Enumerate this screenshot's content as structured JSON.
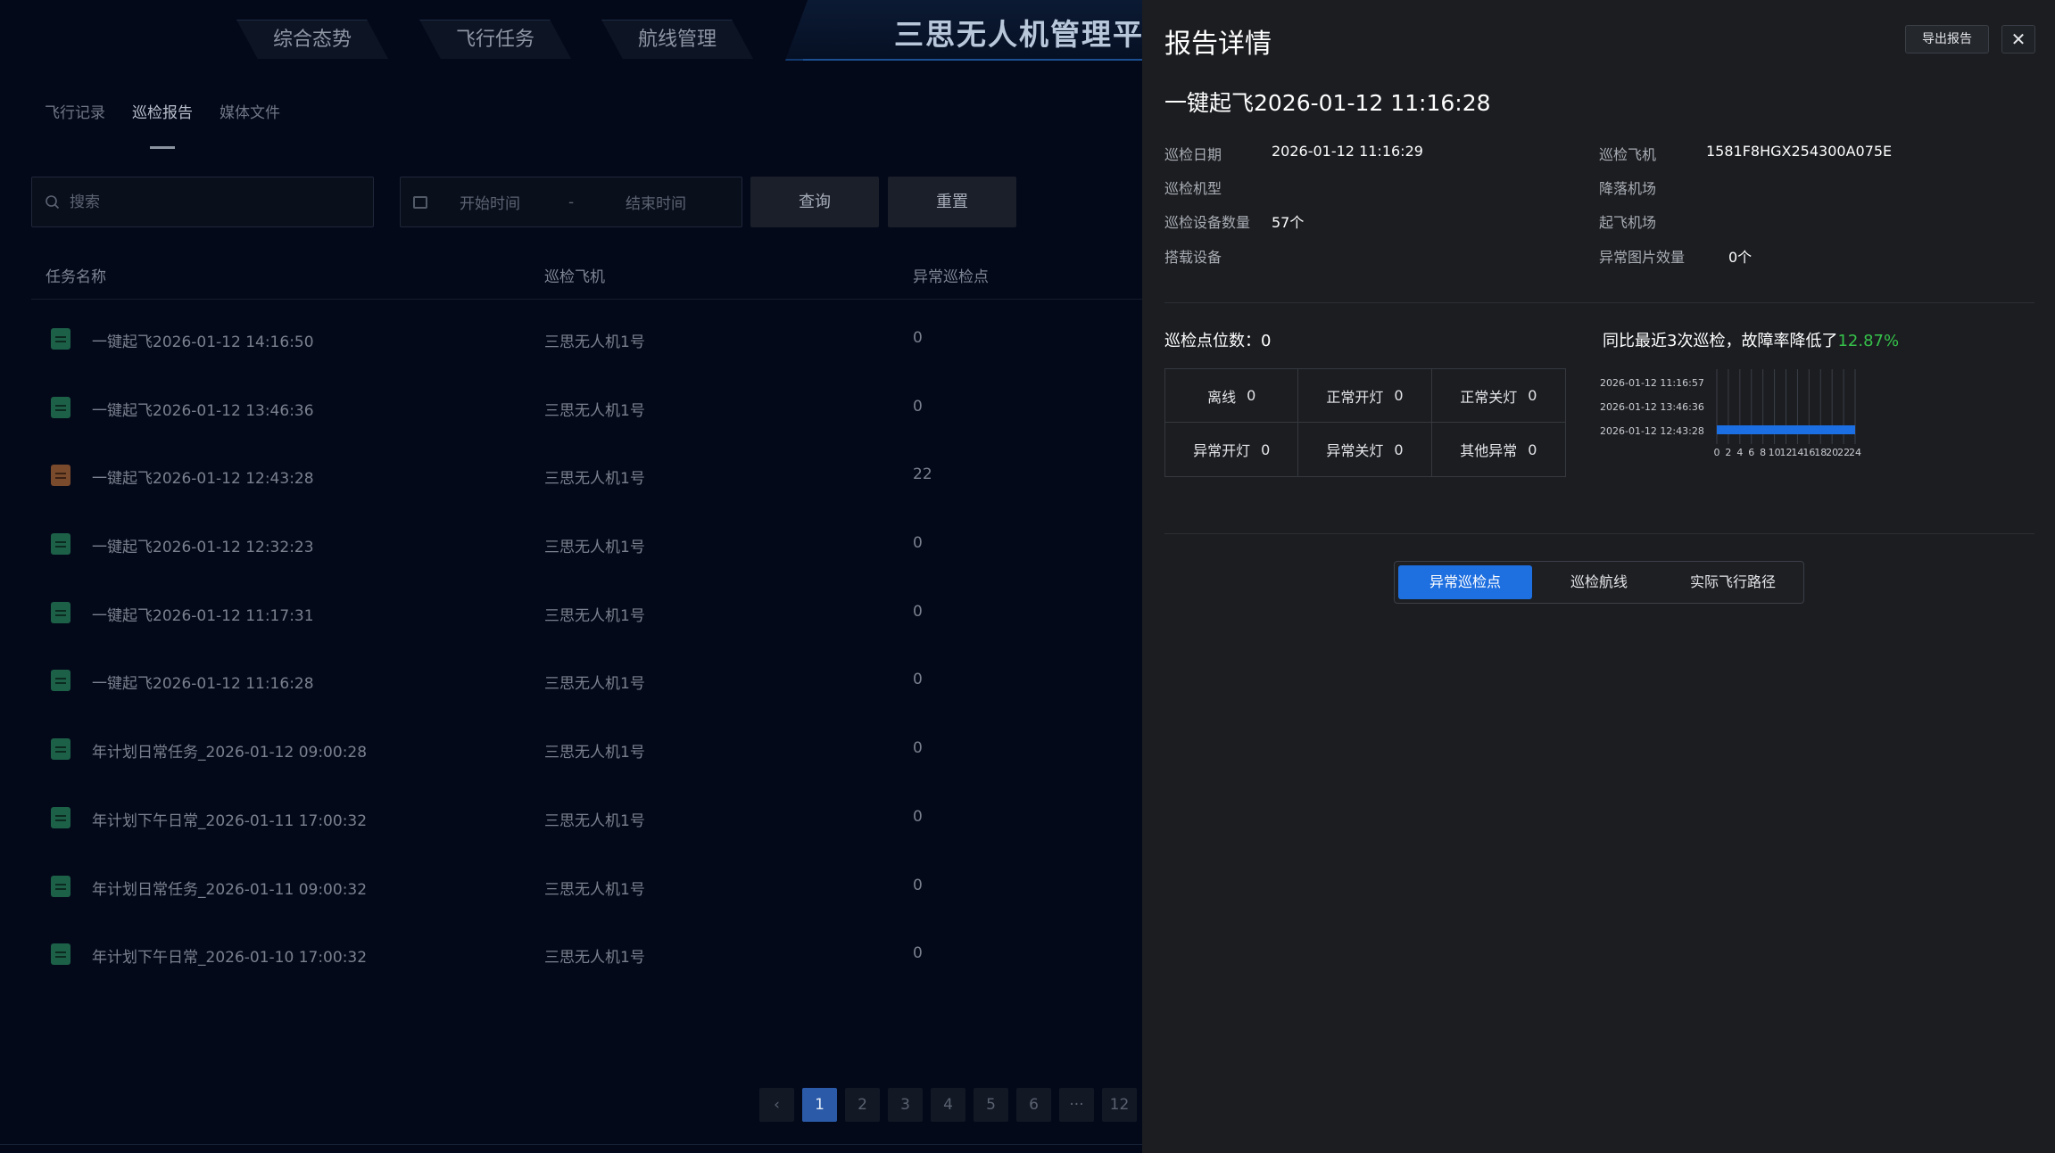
{
  "nav": {
    "tabs": [
      "综合态势",
      "飞行任务",
      "航线管理"
    ],
    "brand_title": "三思无人机管理平台"
  },
  "subtabs": [
    "飞行记录",
    "巡检报告",
    "媒体文件"
  ],
  "active_subtab": "巡检报告",
  "filters": {
    "search_placeholder": "搜索",
    "start_placeholder": "开始时间",
    "separator": "-",
    "end_placeholder": "结束时间",
    "query_label": "查询",
    "reset_label": "重置"
  },
  "table": {
    "headers": [
      "任务名称",
      "巡检飞机",
      "异常巡检点"
    ],
    "rows": [
      {
        "name": "一键起飞2026-01-12 14:16:50",
        "drone": "三思无人机1号",
        "abnormal": "0",
        "status": "normal"
      },
      {
        "name": "一键起飞2026-01-12 13:46:36",
        "drone": "三思无人机1号",
        "abnormal": "0",
        "status": "normal"
      },
      {
        "name": "一键起飞2026-01-12 12:43:28",
        "drone": "三思无人机1号",
        "abnormal": "22",
        "status": "warn"
      },
      {
        "name": "一键起飞2026-01-12 12:32:23",
        "drone": "三思无人机1号",
        "abnormal": "0",
        "status": "normal"
      },
      {
        "name": "一键起飞2026-01-12 11:17:31",
        "drone": "三思无人机1号",
        "abnormal": "0",
        "status": "normal"
      },
      {
        "name": "一键起飞2026-01-12 11:16:28",
        "drone": "三思无人机1号",
        "abnormal": "0",
        "status": "normal"
      },
      {
        "name": "年计划日常任务_2026-01-12 09:00:28",
        "drone": "三思无人机1号",
        "abnormal": "0",
        "status": "normal"
      },
      {
        "name": "年计划下午日常_2026-01-11 17:00:32",
        "drone": "三思无人机1号",
        "abnormal": "0",
        "status": "normal"
      },
      {
        "name": "年计划日常任务_2026-01-11 09:00:32",
        "drone": "三思无人机1号",
        "abnormal": "0",
        "status": "normal"
      },
      {
        "name": "年计划下午日常_2026-01-10 17:00:32",
        "drone": "三思无人机1号",
        "abnormal": "0",
        "status": "normal"
      }
    ]
  },
  "pagination": {
    "prev": "‹",
    "pages": [
      "1",
      "2",
      "3",
      "4",
      "5",
      "6",
      "···",
      "12"
    ],
    "current": "1"
  },
  "drawer": {
    "title": "报告详情",
    "export_label": "导出报告",
    "close_label": "✕",
    "report_name": "一键起飞2026-01-12 11:16:28",
    "info": {
      "date_label": "巡检日期",
      "date_value": "2026-01-12 11:16:29",
      "aircraft_label": "巡检飞机",
      "aircraft_value": "1581F8HGX254300A075E",
      "model_label": "巡检机型",
      "model_value": "",
      "landing_label": "降落机场",
      "landing_value": "",
      "device_count_label": "巡检设备数量",
      "device_count_value": "57个",
      "takeoff_label": "起飞机场",
      "takeoff_value": "",
      "payload_label": "搭载设备",
      "payload_value": "",
      "abnormal_img_label": "异常图片效量",
      "abnormal_img_value": "0个"
    },
    "points_title": "巡检点位数：0",
    "stats": [
      {
        "label": "离线",
        "value": "0"
      },
      {
        "label": "正常开灯",
        "value": "0"
      },
      {
        "label": "正常关灯",
        "value": "0"
      },
      {
        "label": "异常开灯",
        "value": "0"
      },
      {
        "label": "异常关灯",
        "value": "0"
      },
      {
        "label": "其他异常",
        "value": "0"
      }
    ],
    "compare_prefix": "同比最近3次巡检，故障率降低了",
    "compare_pct": "12.87%",
    "segments": [
      "异常巡检点",
      "巡检航线",
      "实际飞行路径"
    ],
    "active_segment": "异常巡检点"
  },
  "colors": {
    "accent_blue": "#1e6fe0",
    "bar_blue": "#1c6fe3",
    "positive_green": "#36c24a",
    "drawer_bg": "#1b1d21"
  },
  "chart_data": {
    "type": "bar",
    "orientation": "horizontal",
    "categories": [
      "2026-01-12 11:16:57",
      "2026-01-12 13:46:36",
      "2026-01-12 12:43:28"
    ],
    "values": [
      0,
      0,
      24
    ],
    "xlim": [
      0,
      24
    ],
    "xticks": [
      0,
      2,
      4,
      6,
      8,
      10,
      12,
      14,
      16,
      18,
      20,
      22,
      24
    ],
    "grid": true
  }
}
